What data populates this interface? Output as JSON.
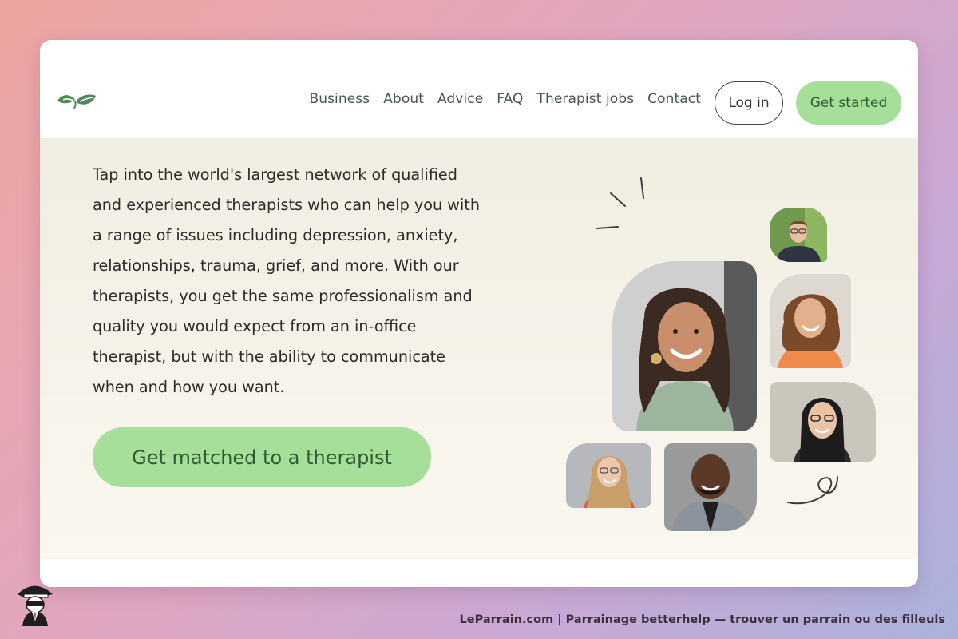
{
  "nav": {
    "links": [
      "Business",
      "About",
      "Advice",
      "FAQ",
      "Therapist jobs",
      "Contact"
    ],
    "login_label": "Log in",
    "get_started_label": "Get started"
  },
  "hero": {
    "text_lines": [
      "Tap into the world's largest network of qualified",
      "and experienced therapists who can help you with",
      "a range of issues including depression, anxiety,",
      "relationships, trauma, grief, and more. With our",
      "therapists, you get the same professionalism and",
      "quality you would expect from an in-office",
      "therapist, but with the ability to communicate",
      "when and how you want."
    ],
    "cta_label": "Get matched to a therapist"
  },
  "caption": "LeParrain.com | Parrainage betterhelp — trouver un parrain ou des filleuls",
  "icons": {
    "logo": "leaf-logo-icon",
    "mascot": "detective-mascot-icon"
  },
  "colors": {
    "accent_green": "#a6df99",
    "accent_text": "#2f5a33",
    "nav_text": "#45574a"
  }
}
